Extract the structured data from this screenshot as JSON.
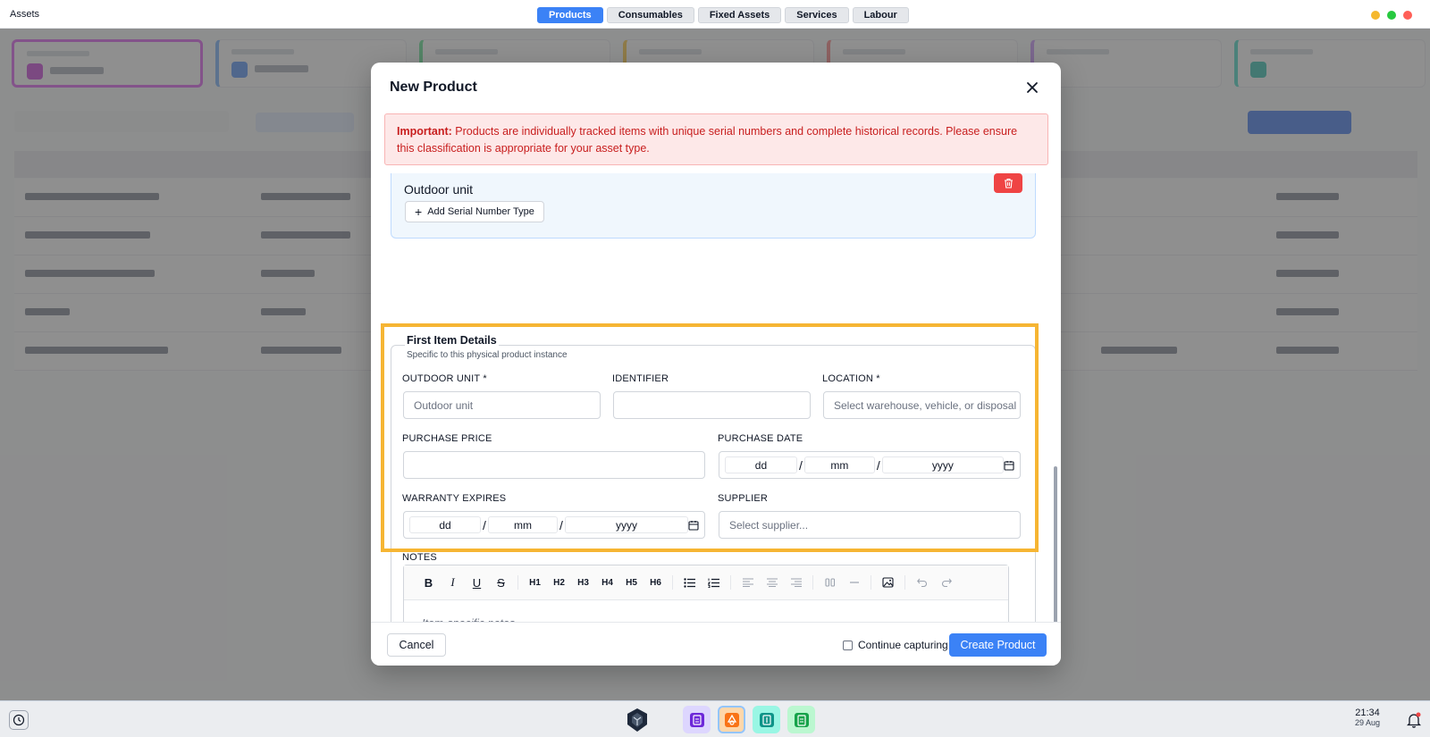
{
  "app": {
    "title": "Assets"
  },
  "top_tabs": [
    {
      "label": "Products",
      "active": true
    },
    {
      "label": "Consumables",
      "active": false
    },
    {
      "label": "Fixed Assets",
      "active": false
    },
    {
      "label": "Services",
      "active": false
    },
    {
      "label": "Labour",
      "active": false
    }
  ],
  "window_controls": [
    "#f5b82e",
    "#27c93f",
    "#ff5f57"
  ],
  "modal": {
    "title": "New Product",
    "alert": {
      "strong": "Important:",
      "text": " Products are individually tracked items with unique serial numbers and complete historical records. Please ensure this classification is appropriate for your asset type."
    },
    "serial_type": {
      "name": "Outdoor unit",
      "add_button": "Add Serial Number Type"
    },
    "first_item": {
      "title": "First Item Details",
      "subtitle": "Specific to this physical product instance",
      "fields": {
        "outdoor_unit": {
          "label": "OUTDOOR UNIT *",
          "placeholder": "Outdoor unit"
        },
        "identifier": {
          "label": "IDENTIFIER",
          "placeholder": ""
        },
        "location": {
          "label": "LOCATION *",
          "placeholder": "Select warehouse, vehicle, or disposal"
        },
        "purchase_price": {
          "label": "PURCHASE PRICE",
          "placeholder": ""
        },
        "purchase_date": {
          "label": "PURCHASE DATE",
          "dd": "dd",
          "mm": "mm",
          "yyyy": "yyyy"
        },
        "warranty_expires": {
          "label": "WARRANTY EXPIRES",
          "dd": "dd",
          "mm": "mm",
          "yyyy": "yyyy"
        },
        "supplier": {
          "label": "SUPPLIER",
          "placeholder": "Select supplier..."
        }
      }
    },
    "notes": {
      "label": "NOTES",
      "placeholder": "Item-specific notes...",
      "toolbar": [
        "B",
        "I",
        "U",
        "S",
        "H1",
        "H2",
        "H3",
        "H4",
        "H5",
        "H6"
      ]
    },
    "footer": {
      "cancel": "Cancel",
      "continue_label": "Continue capturing",
      "continue_checked": false,
      "create": "Create Product"
    }
  },
  "taskbar": {
    "time": "21:34",
    "date": "29 Aug"
  }
}
